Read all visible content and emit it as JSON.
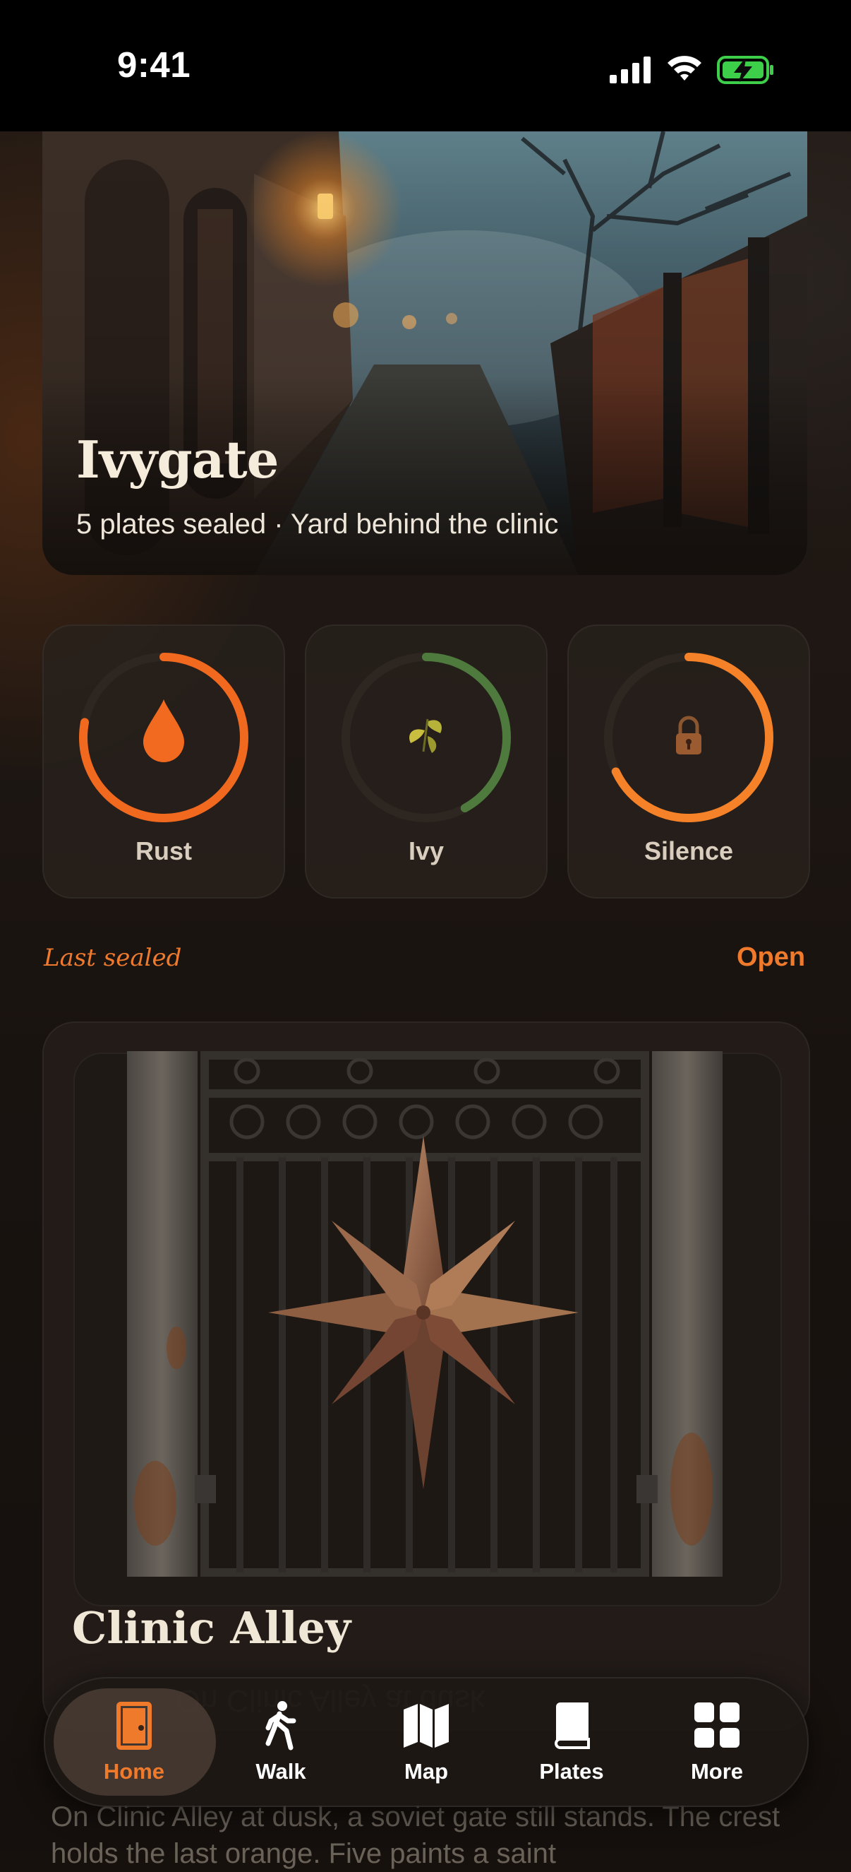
{
  "status_bar": {
    "time": "9:41"
  },
  "hero": {
    "title": "Ivygate",
    "subtitle": "5 plates sealed · Yard behind the clinic"
  },
  "rings": [
    {
      "label": "Rust",
      "icon": "droplet-icon",
      "progress": 0.78,
      "color": "#f0691e"
    },
    {
      "label": "Ivy",
      "icon": "leaf-icon",
      "progress": 0.42,
      "color": "#4e7a3e"
    },
    {
      "label": "Silence",
      "icon": "padlock-icon",
      "progress": 0.68,
      "color": "#f58228"
    }
  ],
  "section": {
    "title": "Last sealed",
    "action": "Open"
  },
  "featured": {
    "image": "iron-gate-with-star",
    "title": "Clinic Alley",
    "description": "On Clinic Alley at dusk, a soviet gate still stands. The crest holds the last orange. Five paints a saint"
  },
  "tabbar": {
    "tabs": [
      {
        "label": "Home",
        "icon": "door-icon",
        "active": true
      },
      {
        "label": "Walk",
        "icon": "walking-person-icon",
        "active": false
      },
      {
        "label": "Map",
        "icon": "map-icon",
        "active": false
      },
      {
        "label": "Plates",
        "icon": "book-icon",
        "active": false
      },
      {
        "label": "More",
        "icon": "grid-icon",
        "active": false
      }
    ]
  },
  "colors": {
    "accent": "#f07a2c",
    "background": "#1c1512",
    "card": "#28211c"
  }
}
